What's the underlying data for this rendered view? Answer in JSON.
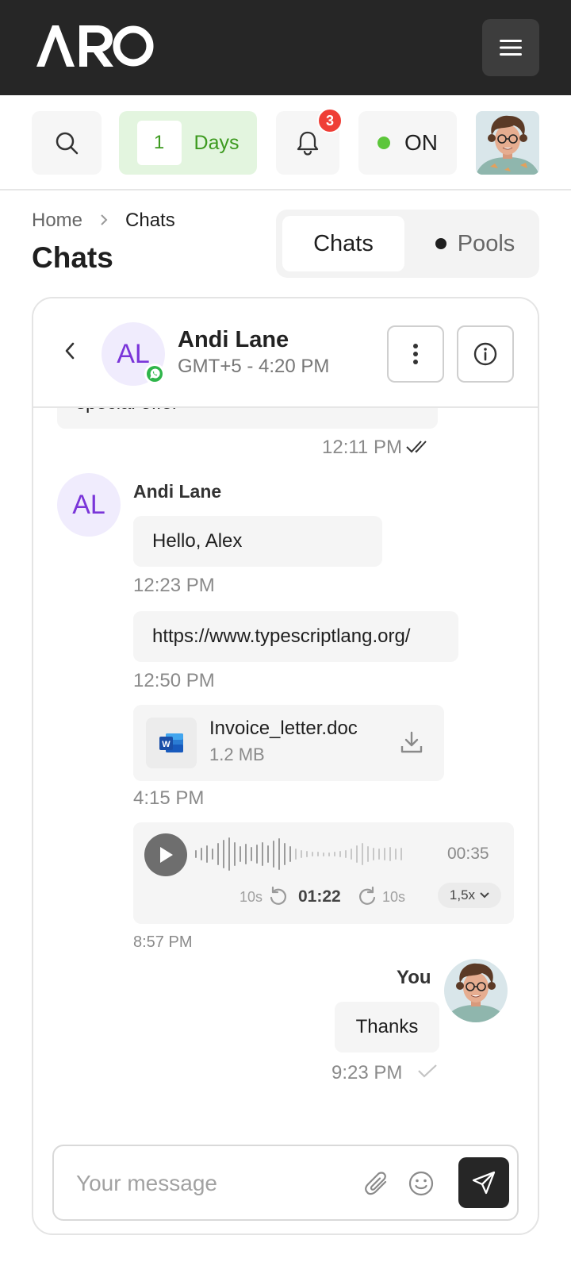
{
  "app": {
    "logo_text": "ARO"
  },
  "toolbar": {
    "days_number": "1",
    "days_label": "Days",
    "notification_count": "3",
    "status_label": "ON"
  },
  "breadcrumb": {
    "home": "Home",
    "current": "Chats"
  },
  "page_title": "Chats",
  "segment": {
    "chats": "Chats",
    "pools": "Pools"
  },
  "chat_header": {
    "initials": "AL",
    "name": "Andi Lane",
    "timezone": "GMT+5 - 4:20 PM"
  },
  "messages": {
    "partial_text": "special offer",
    "partial_time": "12:11 PM",
    "sender_initials": "AL",
    "sender_name": "Andi Lane",
    "msg1_text": "Hello, Alex",
    "msg1_time": "12:23 PM",
    "msg2_text": "https://www.typescriptlang.org/",
    "msg2_time": "12:50 PM",
    "file_name": "Invoice_letter.doc",
    "file_size": "1.2 MB",
    "file_time": "4:15 PM",
    "audio_duration": "00:35",
    "audio_back": "10s",
    "audio_current": "01:22",
    "audio_fwd": "10s",
    "audio_speed": "1,5x",
    "audio_time": "8:57 PM",
    "you_name": "You",
    "you_text": "Thanks",
    "you_time": "9:23 PM"
  },
  "composer": {
    "placeholder": "Your message"
  },
  "colors": {
    "accent_green": "#3d9a1f",
    "badge_red": "#ef3e36",
    "avatar_purple": "#7a35d9",
    "dark": "#262626"
  }
}
